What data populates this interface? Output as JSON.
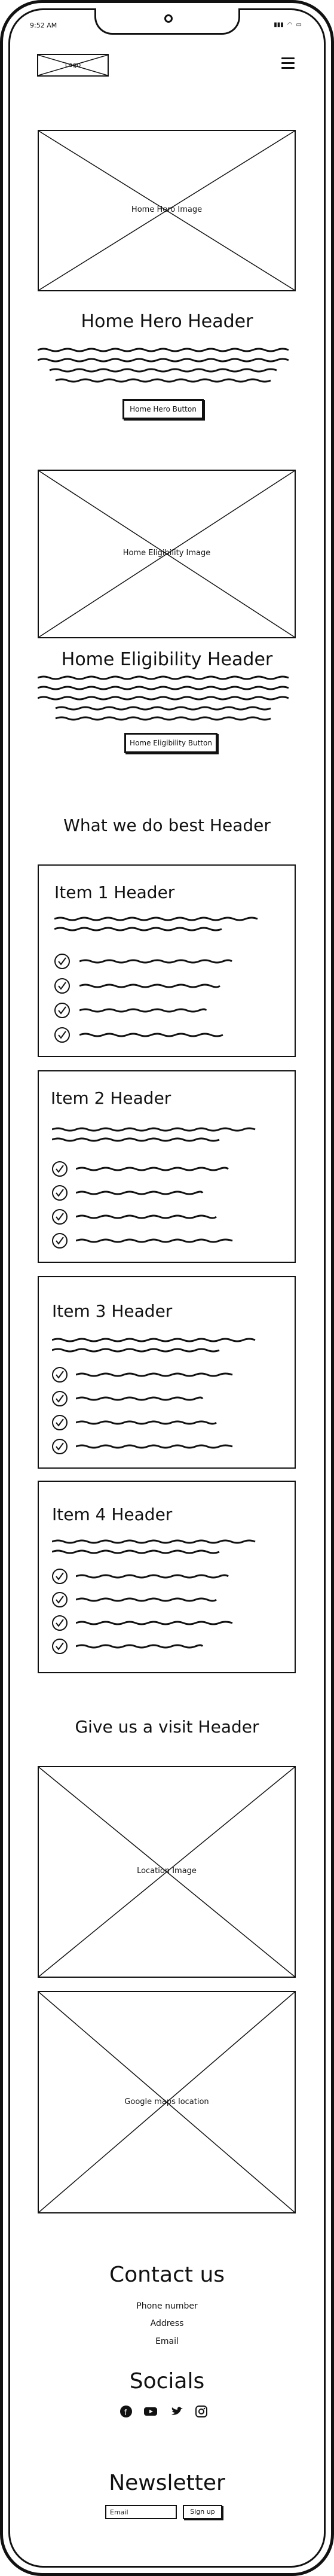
{
  "status_bar": {
    "time": "9:52 AM",
    "icons": [
      "signal-icon",
      "wifi-icon",
      "battery-icon"
    ]
  },
  "header": {
    "logo_label": "Logo",
    "menu_icon": "hamburger-menu-icon"
  },
  "hero": {
    "image_label": "Home Hero Image",
    "title": "Home Hero Header",
    "button_label": "Home Hero Button"
  },
  "eligibility": {
    "image_label": "Home Eligibility Image",
    "title": "Home Eligibility Header",
    "button_label": "Home Eligibility Button"
  },
  "services": {
    "title": "What we do best Header",
    "items": [
      {
        "title": "Item 1 Header"
      },
      {
        "title": "Item 2 Header"
      },
      {
        "title": "Item 3 Header"
      },
      {
        "title": "Item 4 Header"
      }
    ]
  },
  "visit": {
    "title": "Give us a visit Header",
    "location_image_label": "Location Image",
    "map_label": "Google maps location"
  },
  "contact": {
    "title": "Contact us",
    "phone": "Phone number",
    "address": "Address",
    "email": "Email"
  },
  "socials": {
    "title": "Socials",
    "icons": [
      "facebook-icon",
      "youtube-icon",
      "twitter-icon",
      "instagram-icon"
    ]
  },
  "newsletter": {
    "title": "Newsletter",
    "input_placeholder": "Email",
    "button_label": "Sign up"
  }
}
